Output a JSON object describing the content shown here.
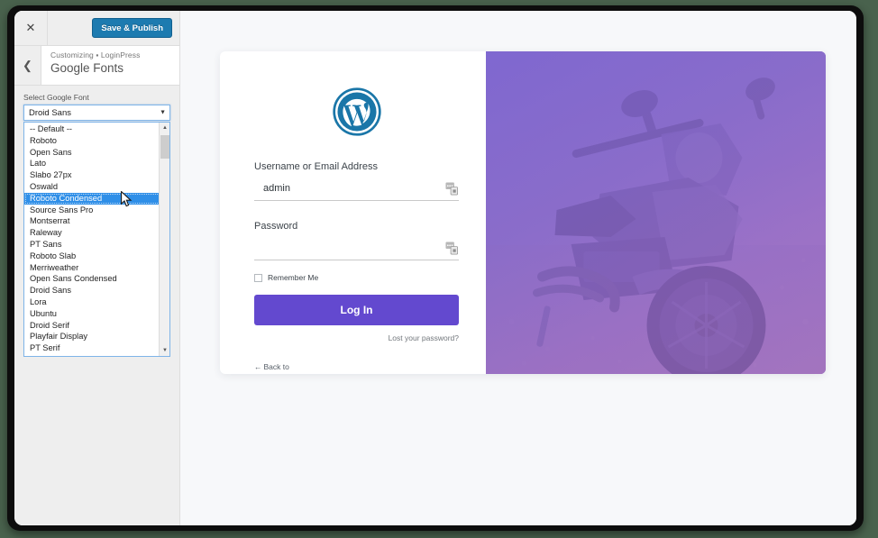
{
  "customizer": {
    "close_icon": "close-icon",
    "save_label": "Save & Publish",
    "back_icon": "chevron-left-icon",
    "breadcrumb": "Customizing ▪ LoginPress",
    "panel_title": "Google Fonts"
  },
  "control": {
    "label": "Select Google Font",
    "selected_value": "Droid Sans",
    "dropdown_arrow_icon": "chevron-down-icon",
    "scroll_up_icon": "scroll-up-arrow-icon",
    "scroll_down_icon": "scroll-down-arrow-icon",
    "options": [
      "-- Default --",
      "Roboto",
      "Open Sans",
      "Lato",
      "Slabo 27px",
      "Oswald",
      "Roboto Condensed",
      "Source Sans Pro",
      "Montserrat",
      "Raleway",
      "PT Sans",
      "Roboto Slab",
      "Merriweather",
      "Open Sans Condensed",
      "Droid Sans",
      "Lora",
      "Ubuntu",
      "Droid Serif",
      "Playfair Display",
      "PT Serif"
    ],
    "highlighted_option": "Roboto Condensed"
  },
  "login": {
    "logo_icon": "wordpress-logo-icon",
    "username_label": "Username or Email Address",
    "username_value": "admin",
    "username_autofill_icon": "password-manager-icon",
    "password_label": "Password",
    "password_value": "",
    "password_autofill_icon": "password-manager-icon",
    "remember_label": "Remember Me",
    "remember_checked": false,
    "submit_label": "Log In",
    "lost_password_label": "Lost your password?",
    "back_arrow_icon": "left-arrow-icon",
    "back_label": "Back to"
  },
  "colors": {
    "save_button": "#1d7bb0",
    "login_button": "#6349cf",
    "option_highlight": "#2f8fe8",
    "overlay_purple": "#7c64ce",
    "desktop_background": "#49624d"
  },
  "preview_image": {
    "name": "motorcycle-photo",
    "overlay": "purple-gradient-overlay"
  }
}
